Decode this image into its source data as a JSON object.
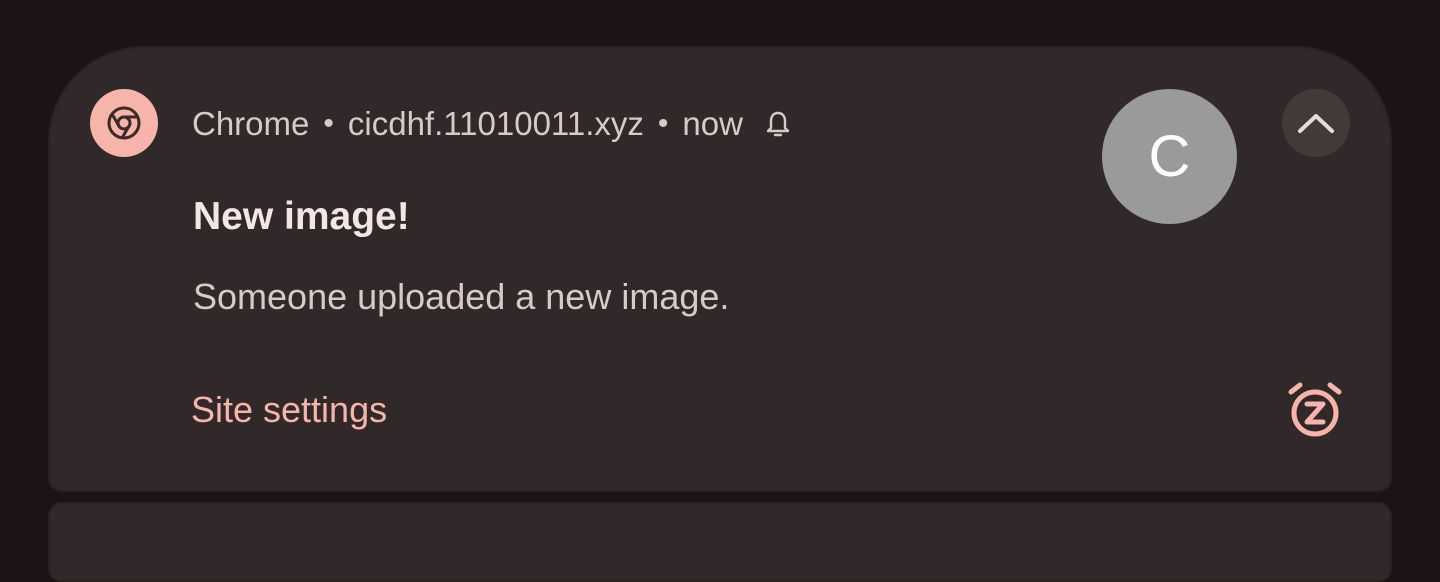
{
  "notification": {
    "app_name": "Chrome",
    "separator": "•",
    "site": "cicdhf.11010011.xyz",
    "time": "now",
    "title": "New image!",
    "body": "Someone uploaded a new image.",
    "action_label": "Site settings",
    "avatar_letter": "C"
  },
  "icons": {
    "app": "chrome-icon",
    "alerting": "bell-icon",
    "expand": "chevron-up-icon",
    "snooze": "snooze-alarm-icon"
  },
  "colors": {
    "background": "#1c1414",
    "card": "#312929",
    "accent": "#f7b4aa",
    "avatar": "#9a9a9a"
  }
}
